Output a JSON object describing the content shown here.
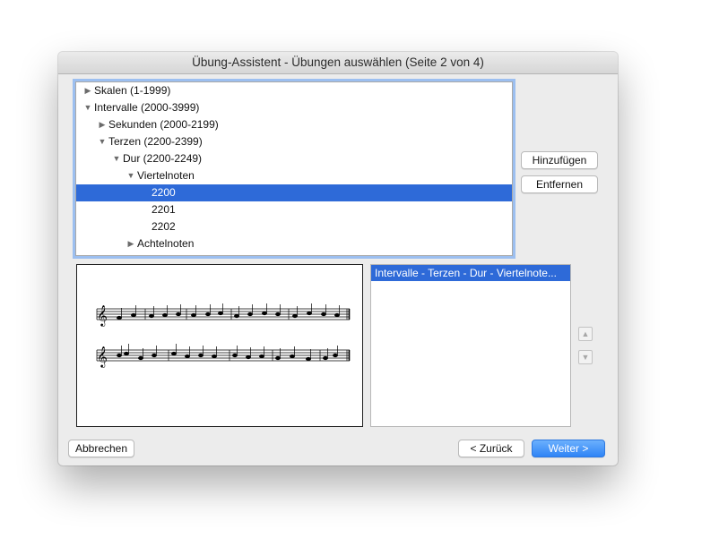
{
  "window": {
    "title": "Übung-Assistent - Übungen auswählen (Seite 2 von 4)"
  },
  "tree": {
    "rows": [
      {
        "label": "Skalen (1-1999)",
        "expanded": false,
        "level": 0
      },
      {
        "label": "Intervalle (2000-3999)",
        "expanded": true,
        "level": 0
      },
      {
        "label": "Sekunden (2000-2199)",
        "expanded": false,
        "level": 1
      },
      {
        "label": "Terzen (2200-2399)",
        "expanded": true,
        "level": 1
      },
      {
        "label": "Dur (2200-2249)",
        "expanded": true,
        "level": 2
      },
      {
        "label": "Viertelnoten",
        "expanded": true,
        "level": 3
      },
      {
        "label": "2200",
        "selected": true,
        "level": 4
      },
      {
        "label": "2201",
        "level": 4
      },
      {
        "label": "2202",
        "level": 4
      },
      {
        "label": "Achtelnoten",
        "expanded": false,
        "level": 3
      }
    ]
  },
  "buttons": {
    "add": "Hinzufügen",
    "remove": "Entfernen",
    "cancel": "Abbrechen",
    "back": "< Zurück",
    "next": "Weiter >"
  },
  "selected_list": {
    "items": [
      "Intervalle  - Terzen  - Dur  - Viertelnote..."
    ]
  },
  "icons": {
    "expanded": "triangle-down-icon",
    "collapsed": "triangle-right-icon",
    "move_up": "chevron-up-icon",
    "move_down": "chevron-down-icon"
  },
  "colors": {
    "selection": "#2e6ad8",
    "focus_ring": "#9cbff0",
    "primary_button": "#3a8cf7"
  }
}
